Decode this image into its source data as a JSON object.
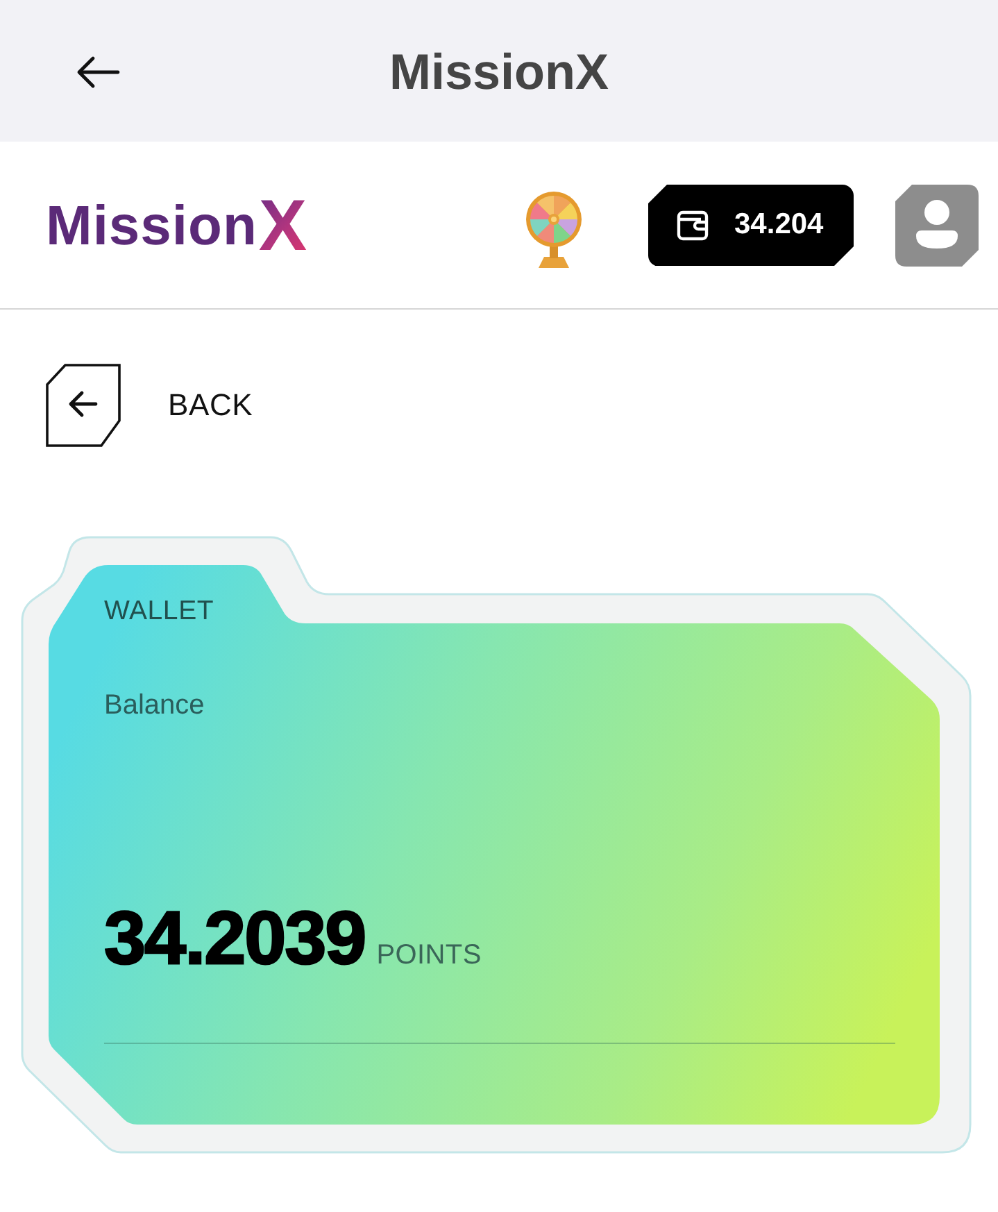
{
  "app_bar": {
    "title": "MissionX"
  },
  "header": {
    "logo": {
      "word": "Mission",
      "mark": "X"
    },
    "wallet_balance": "34.204"
  },
  "back_link": {
    "label": "BACK"
  },
  "wallet_card": {
    "tab_label": "WALLET",
    "label": "Balance",
    "amount": "34.2039",
    "unit": "POINTS"
  }
}
